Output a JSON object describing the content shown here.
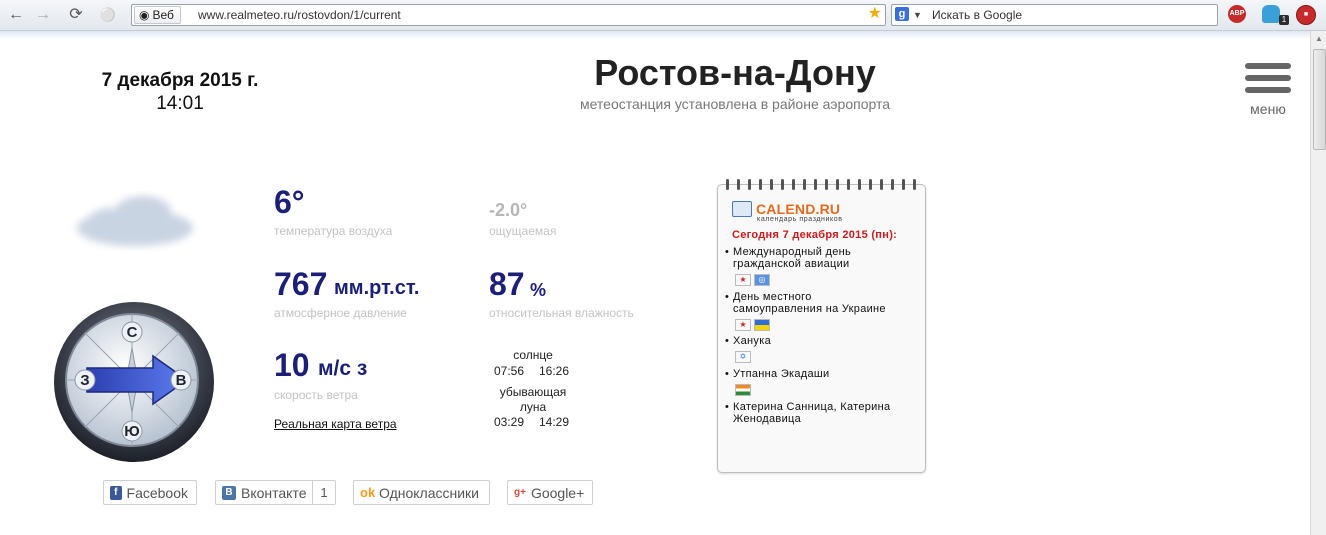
{
  "browser": {
    "web_chip": "Веб",
    "url": "www.realmeteo.ru/rostovdon/1/current",
    "search_placeholder": "Искать в Google",
    "search_engine_badge": "g",
    "ext_badge_count": "1",
    "adblock_label": "ABP"
  },
  "header": {
    "date": "7 декабря 2015 г.",
    "time": "14:01",
    "city": "Ростов-на-Дону",
    "subtitle": "метеостанция установлена в районе аэропорта",
    "menu_label": "меню"
  },
  "weather": {
    "temperature": "6°",
    "temperature_label": "температура воздуха",
    "feels_like": "-2.0°",
    "feels_like_label": "ощущаемая",
    "pressure_value": "767",
    "pressure_unit": "мм.рт.ст.",
    "pressure_label": "атмосферное давление",
    "humidity_value": "87",
    "humidity_unit": "%",
    "humidity_label": "относительная влажность",
    "wind_value": "10",
    "wind_unit": "м/с з",
    "wind_label": "скорость ветра",
    "wind_map_link": "Реальная карта ветра"
  },
  "compass": {
    "north": "С",
    "south": "Ю",
    "west": "З",
    "east": "В"
  },
  "astro": {
    "sun_label": "солнце",
    "sunrise": "07:56",
    "sunset": "16:26",
    "moon_phase_line1": "убывающая",
    "moon_phase_line2": "луна",
    "moonrise": "03:29",
    "moonset": "14:29"
  },
  "calendar": {
    "brand": "CALEND.RU",
    "tagline": "календарь праздников",
    "today": "Сегодня 7 декабря 2015 (пн):",
    "items": [
      {
        "line1": "Международный день",
        "line2": "гражданской авиации"
      },
      {
        "line1": "День местного",
        "line2": "самоуправления на Украине"
      },
      {
        "line1": "Ханука",
        "line2": ""
      },
      {
        "line1": "Утпанна Экадаши",
        "line2": ""
      },
      {
        "line1": "Катерина Санница, Катерина",
        "line2": "Женодавица"
      }
    ]
  },
  "social": {
    "facebook": "Facebook",
    "vkontakte": "Вконтакте",
    "vk_count": "1",
    "odnoklassniki": "Одноклассники",
    "googleplus": "Google+"
  },
  "colors": {
    "value_blue": "#1b1f77",
    "calendar_red": "#cc1a1a",
    "calendar_orange": "#e56b1f"
  }
}
